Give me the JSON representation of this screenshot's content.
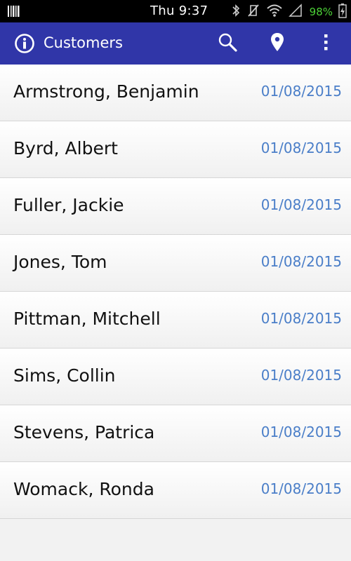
{
  "status_bar": {
    "time": "Thu 9:37",
    "battery": "98%"
  },
  "app_bar": {
    "title": "Customers",
    "icons": [
      "info-icon",
      "search-icon",
      "location-pin-icon",
      "overflow-menu-icon"
    ]
  },
  "customers": [
    {
      "name": "Armstrong, Benjamin",
      "date": "01/08/2015"
    },
    {
      "name": "Byrd, Albert",
      "date": "01/08/2015"
    },
    {
      "name": "Fuller, Jackie",
      "date": "01/08/2015"
    },
    {
      "name": "Jones, Tom",
      "date": "01/08/2015"
    },
    {
      "name": "Pittman, Mitchell",
      "date": "01/08/2015"
    },
    {
      "name": "Sims, Collin",
      "date": "01/08/2015"
    },
    {
      "name": "Stevens, Patrica",
      "date": "01/08/2015"
    },
    {
      "name": "Womack, Ronda",
      "date": "01/08/2015"
    }
  ],
  "colors": {
    "app_bar": "#3036a8",
    "date_text": "#4a7ec8",
    "battery_text": "#4cd137"
  }
}
